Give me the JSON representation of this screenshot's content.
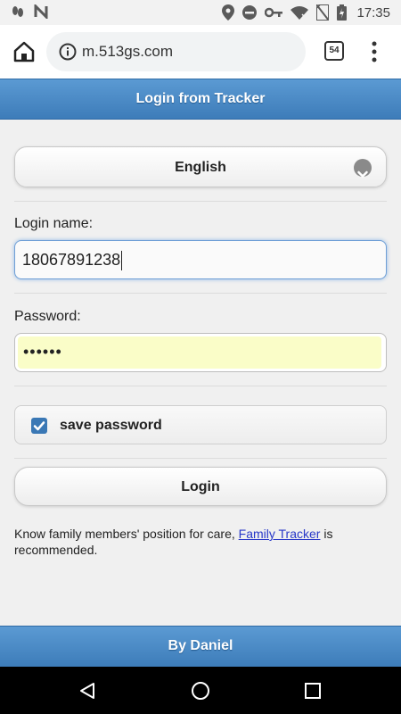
{
  "status_bar": {
    "time": "17:35",
    "icons_left": [
      "footprints-icon",
      "n-icon"
    ],
    "icons_right": [
      "location-icon",
      "dnd-icon",
      "key-icon",
      "wifi-icon",
      "no-sim-icon",
      "battery-charging-icon"
    ]
  },
  "browser": {
    "url": "m.513gs.com",
    "tab_count": "54"
  },
  "header": {
    "title": "Login from Tracker"
  },
  "form": {
    "language_selected": "English",
    "login_label": "Login name:",
    "login_value": "18067891238",
    "password_label": "Password:",
    "password_masked": "••••••",
    "save_password_label": "save password",
    "save_password_checked": true,
    "login_button": "Login",
    "note_before": "Know family members' position for care, ",
    "note_link": "Family Tracker",
    "note_after": " is recommended."
  },
  "footer": {
    "text": "By Daniel"
  },
  "colors": {
    "header_blue": "#4a8ac6",
    "checkbox_blue": "#3a78b5",
    "autofill_yellow": "#fafdc8",
    "link_blue": "#2838c8"
  }
}
